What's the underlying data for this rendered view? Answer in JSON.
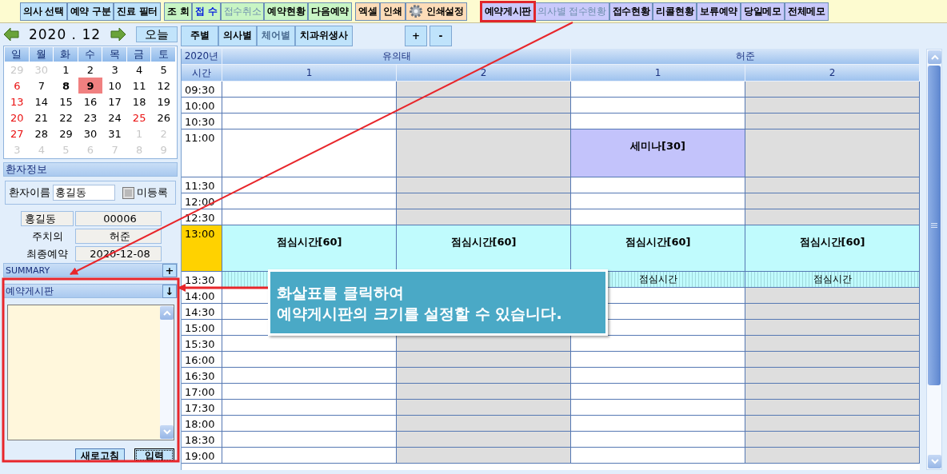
{
  "toolbar": [
    {
      "label": "의사 선택",
      "kind": "doctor",
      "emphasis": false,
      "disabled": false,
      "highlighted": false
    },
    {
      "label": "예약 구분",
      "kind": "doctor",
      "emphasis": false,
      "disabled": false,
      "highlighted": false
    },
    {
      "label": "진료 필터",
      "kind": "doctor",
      "emphasis": false,
      "disabled": false,
      "highlighted": false
    },
    {
      "label": "조  회",
      "kind": "reception",
      "emphasis": false,
      "disabled": false,
      "highlighted": false
    },
    {
      "label": "접  수",
      "kind": "reception",
      "emphasis": true,
      "disabled": false,
      "highlighted": false
    },
    {
      "label": "접수취소",
      "kind": "reception",
      "emphasis": false,
      "disabled": true,
      "highlighted": false
    },
    {
      "label": "예약현황",
      "kind": "reception",
      "emphasis": false,
      "disabled": false,
      "highlighted": false
    },
    {
      "label": "다음예약",
      "kind": "reception",
      "emphasis": false,
      "disabled": false,
      "highlighted": false
    },
    {
      "label": "엑셀",
      "kind": "output",
      "emphasis": false,
      "disabled": false,
      "highlighted": false
    },
    {
      "label": "인쇄",
      "kind": "output",
      "emphasis": false,
      "disabled": false,
      "highlighted": false
    },
    {
      "label": "인쇄설정",
      "kind": "output",
      "emphasis": false,
      "disabled": false,
      "highlighted": false,
      "gear": true
    },
    {
      "label": "예약게시판",
      "kind": "board",
      "emphasis": false,
      "disabled": false,
      "highlighted": true
    },
    {
      "label": "의사별 접수현황",
      "kind": "board",
      "emphasis": false,
      "disabled": true,
      "highlighted": false
    },
    {
      "label": "접수현황",
      "kind": "board",
      "emphasis": false,
      "disabled": false,
      "highlighted": false
    },
    {
      "label": "리콜현황",
      "kind": "board",
      "emphasis": false,
      "disabled": false,
      "highlighted": false
    },
    {
      "label": "보류예약",
      "kind": "board",
      "emphasis": false,
      "disabled": false,
      "highlighted": false
    },
    {
      "label": "당일메모",
      "kind": "board",
      "emphasis": false,
      "disabled": false,
      "highlighted": false
    },
    {
      "label": "전체메모",
      "kind": "board",
      "emphasis": false,
      "disabled": false,
      "highlighted": false
    }
  ],
  "month_nav": {
    "month": "2020 . 12",
    "today_button": "오늘"
  },
  "calendar": {
    "weekdays": [
      "일",
      "월",
      "화",
      "수",
      "목",
      "금",
      "토"
    ],
    "weeks": [
      [
        {
          "day": "29",
          "muted": true,
          "holiday": false,
          "bold": false,
          "selected": false
        },
        {
          "day": "30",
          "muted": true,
          "holiday": false,
          "bold": false,
          "selected": false
        },
        {
          "day": "1",
          "muted": false,
          "holiday": false,
          "bold": false,
          "selected": false
        },
        {
          "day": "2",
          "muted": false,
          "holiday": false,
          "bold": false,
          "selected": false
        },
        {
          "day": "3",
          "muted": false,
          "holiday": false,
          "bold": false,
          "selected": false
        },
        {
          "day": "4",
          "muted": false,
          "holiday": false,
          "bold": false,
          "selected": false
        },
        {
          "day": "5",
          "muted": false,
          "holiday": false,
          "bold": false,
          "selected": false
        }
      ],
      [
        {
          "day": "6",
          "muted": false,
          "holiday": true,
          "bold": false,
          "selected": false
        },
        {
          "day": "7",
          "muted": false,
          "holiday": false,
          "bold": false,
          "selected": false
        },
        {
          "day": "8",
          "muted": false,
          "holiday": false,
          "bold": true,
          "selected": false
        },
        {
          "day": "9",
          "muted": false,
          "holiday": false,
          "bold": true,
          "selected": true
        },
        {
          "day": "10",
          "muted": false,
          "holiday": false,
          "bold": false,
          "selected": false
        },
        {
          "day": "11",
          "muted": false,
          "holiday": false,
          "bold": false,
          "selected": false
        },
        {
          "day": "12",
          "muted": false,
          "holiday": false,
          "bold": false,
          "selected": false
        }
      ],
      [
        {
          "day": "13",
          "muted": false,
          "holiday": true,
          "bold": false,
          "selected": false
        },
        {
          "day": "14",
          "muted": false,
          "holiday": false,
          "bold": false,
          "selected": false
        },
        {
          "day": "15",
          "muted": false,
          "holiday": false,
          "bold": false,
          "selected": false
        },
        {
          "day": "16",
          "muted": false,
          "holiday": false,
          "bold": false,
          "selected": false
        },
        {
          "day": "17",
          "muted": false,
          "holiday": false,
          "bold": false,
          "selected": false
        },
        {
          "day": "18",
          "muted": false,
          "holiday": false,
          "bold": false,
          "selected": false
        },
        {
          "day": "19",
          "muted": false,
          "holiday": false,
          "bold": false,
          "selected": false
        }
      ],
      [
        {
          "day": "20",
          "muted": false,
          "holiday": true,
          "bold": false,
          "selected": false
        },
        {
          "day": "21",
          "muted": false,
          "holiday": false,
          "bold": false,
          "selected": false
        },
        {
          "day": "22",
          "muted": false,
          "holiday": false,
          "bold": false,
          "selected": false
        },
        {
          "day": "23",
          "muted": false,
          "holiday": false,
          "bold": false,
          "selected": false
        },
        {
          "day": "24",
          "muted": false,
          "holiday": false,
          "bold": false,
          "selected": false
        },
        {
          "day": "25",
          "muted": false,
          "holiday": true,
          "bold": false,
          "selected": false
        },
        {
          "day": "26",
          "muted": false,
          "holiday": false,
          "bold": false,
          "selected": false
        }
      ],
      [
        {
          "day": "27",
          "muted": false,
          "holiday": true,
          "bold": false,
          "selected": false
        },
        {
          "day": "28",
          "muted": false,
          "holiday": false,
          "bold": false,
          "selected": false
        },
        {
          "day": "29",
          "muted": false,
          "holiday": false,
          "bold": false,
          "selected": false
        },
        {
          "day": "30",
          "muted": false,
          "holiday": false,
          "bold": false,
          "selected": false
        },
        {
          "day": "31",
          "muted": false,
          "holiday": false,
          "bold": false,
          "selected": false
        },
        {
          "day": "1",
          "muted": true,
          "holiday": false,
          "bold": false,
          "selected": false
        },
        {
          "day": "2",
          "muted": true,
          "holiday": false,
          "bold": false,
          "selected": false
        }
      ],
      [
        {
          "day": "3",
          "muted": true,
          "holiday": false,
          "bold": false,
          "selected": false
        },
        {
          "day": "4",
          "muted": true,
          "holiday": false,
          "bold": false,
          "selected": false
        },
        {
          "day": "5",
          "muted": true,
          "holiday": false,
          "bold": false,
          "selected": false
        },
        {
          "day": "6",
          "muted": true,
          "holiday": false,
          "bold": false,
          "selected": false
        },
        {
          "day": "7",
          "muted": true,
          "holiday": false,
          "bold": false,
          "selected": false
        },
        {
          "day": "8",
          "muted": true,
          "holiday": false,
          "bold": false,
          "selected": false
        },
        {
          "day": "9",
          "muted": true,
          "holiday": false,
          "bold": false,
          "selected": false
        }
      ]
    ]
  },
  "patient": {
    "title": "환자정보",
    "name_label": "환자이름",
    "name_value": "홍길동",
    "unregistered": {
      "label": "미등록",
      "checked": false
    },
    "name": "홍길동",
    "chart_no": "00006",
    "doctor_label": "주치의",
    "doctor": "허준",
    "last_label": "최종예약",
    "last_date": "2020-12-08"
  },
  "summary": {
    "title": "SUMMARY",
    "button": "+"
  },
  "board": {
    "title": "예약게시판",
    "button": "↓",
    "buttons": [
      {
        "label": "새로고침",
        "focused": false
      },
      {
        "label": "입력",
        "focused": true
      }
    ]
  },
  "view_tabs": [
    {
      "label": "주별",
      "selected": false
    },
    {
      "label": "의사별",
      "selected": false
    },
    {
      "label": "체어별",
      "selected": true
    },
    {
      "label": "치과위생사",
      "selected": false
    }
  ],
  "zoom_buttons": [
    "+",
    "-"
  ],
  "schedule": {
    "year": "2020년",
    "time_label": "시간",
    "doctors": [
      {
        "name": "유의태",
        "chairs": [
          "1",
          "2"
        ]
      },
      {
        "name": "허준",
        "chairs": [
          "1",
          "2"
        ]
      }
    ],
    "rows": [
      {
        "time": "09:30",
        "kind": "slot",
        "current": false,
        "cells": [
          {
            "kind": "open"
          },
          {
            "kind": "closed"
          },
          {
            "kind": "open"
          },
          {
            "kind": "closed"
          }
        ]
      },
      {
        "time": "10:00",
        "kind": "slot",
        "current": false,
        "cells": [
          {
            "kind": "open"
          },
          {
            "kind": "closed"
          },
          {
            "kind": "open"
          },
          {
            "kind": "closed"
          }
        ]
      },
      {
        "time": "10:30",
        "kind": "slot",
        "current": false,
        "cells": [
          {
            "kind": "open"
          },
          {
            "kind": "closed"
          },
          {
            "kind": "open"
          },
          {
            "kind": "closed"
          }
        ]
      },
      {
        "time": "11:00",
        "kind": "tall",
        "current": false,
        "cells": [
          {
            "kind": "open"
          },
          {
            "kind": "closed"
          },
          {
            "kind": "event",
            "text": "세미나[30]"
          },
          {
            "kind": "closed"
          }
        ]
      },
      {
        "time": "11:30",
        "kind": "slot",
        "current": false,
        "cells": [
          {
            "kind": "open"
          },
          {
            "kind": "closed"
          },
          {
            "kind": "open"
          },
          {
            "kind": "closed"
          }
        ]
      },
      {
        "time": "12:00",
        "kind": "slot",
        "current": false,
        "cells": [
          {
            "kind": "open"
          },
          {
            "kind": "closed"
          },
          {
            "kind": "open"
          },
          {
            "kind": "closed"
          }
        ]
      },
      {
        "time": "12:30",
        "kind": "slot",
        "current": false,
        "cells": [
          {
            "kind": "open"
          },
          {
            "kind": "closed"
          },
          {
            "kind": "open"
          },
          {
            "kind": "closed"
          }
        ]
      },
      {
        "time": "13:00",
        "kind": "tall",
        "current": true,
        "cells": [
          {
            "kind": "lunch",
            "text": "점심시간[60]"
          },
          {
            "kind": "lunch",
            "text": "점심시간[60]"
          },
          {
            "kind": "lunch",
            "text": "점심시간[60]"
          },
          {
            "kind": "lunch",
            "text": "점심시간[60]"
          }
        ]
      },
      {
        "time": "13:30",
        "kind": "slot",
        "current": false,
        "cells": [
          {
            "kind": "break"
          },
          null,
          {
            "kind": "break",
            "text": "점심시간"
          },
          {
            "kind": "break",
            "text": "점심시간"
          }
        ]
      },
      {
        "time": "14:00",
        "kind": "slot",
        "current": false,
        "cells": [
          {
            "kind": "open"
          },
          null,
          {
            "kind": "open"
          },
          {
            "kind": "closed"
          }
        ]
      },
      {
        "time": "14:30",
        "kind": "slot",
        "current": false,
        "cells": [
          {
            "kind": "open"
          },
          null,
          {
            "kind": "open"
          },
          {
            "kind": "closed"
          }
        ]
      },
      {
        "time": "15:00",
        "kind": "slot",
        "current": false,
        "cells": [
          {
            "kind": "open"
          },
          null,
          {
            "kind": "open"
          },
          {
            "kind": "closed"
          }
        ]
      },
      {
        "time": "15:30",
        "kind": "slot",
        "current": false,
        "cells": [
          {
            "kind": "open"
          },
          {
            "kind": "closed"
          },
          {
            "kind": "open"
          },
          {
            "kind": "closed"
          }
        ]
      },
      {
        "time": "16:00",
        "kind": "slot",
        "current": false,
        "cells": [
          {
            "kind": "open"
          },
          {
            "kind": "closed"
          },
          {
            "kind": "open"
          },
          {
            "kind": "closed"
          }
        ]
      },
      {
        "time": "16:30",
        "kind": "slot",
        "current": false,
        "cells": [
          {
            "kind": "open"
          },
          {
            "kind": "closed"
          },
          {
            "kind": "open"
          },
          {
            "kind": "closed"
          }
        ]
      },
      {
        "time": "17:00",
        "kind": "slot",
        "current": false,
        "cells": [
          {
            "kind": "open"
          },
          {
            "kind": "closed"
          },
          {
            "kind": "open"
          },
          {
            "kind": "closed"
          }
        ]
      },
      {
        "time": "17:30",
        "kind": "slot",
        "current": false,
        "cells": [
          {
            "kind": "open"
          },
          {
            "kind": "closed"
          },
          {
            "kind": "open"
          },
          {
            "kind": "closed"
          }
        ]
      },
      {
        "time": "18:00",
        "kind": "slot",
        "current": false,
        "cells": [
          {
            "kind": "open"
          },
          {
            "kind": "closed"
          },
          {
            "kind": "open"
          },
          {
            "kind": "closed"
          }
        ]
      },
      {
        "time": "18:30",
        "kind": "slot",
        "current": false,
        "cells": [
          {
            "kind": "open"
          },
          {
            "kind": "closed"
          },
          {
            "kind": "open"
          },
          {
            "kind": "closed"
          }
        ]
      },
      {
        "time": "19:00",
        "kind": "slot",
        "current": false,
        "cells": [
          {
            "kind": "open"
          },
          {
            "kind": "closed"
          },
          {
            "kind": "open"
          },
          {
            "kind": "closed"
          }
        ]
      }
    ]
  },
  "callout": {
    "lines": [
      "화살표를 클릭하여",
      "예약게시판의 크기를 설정할 수 있습니다."
    ]
  }
}
